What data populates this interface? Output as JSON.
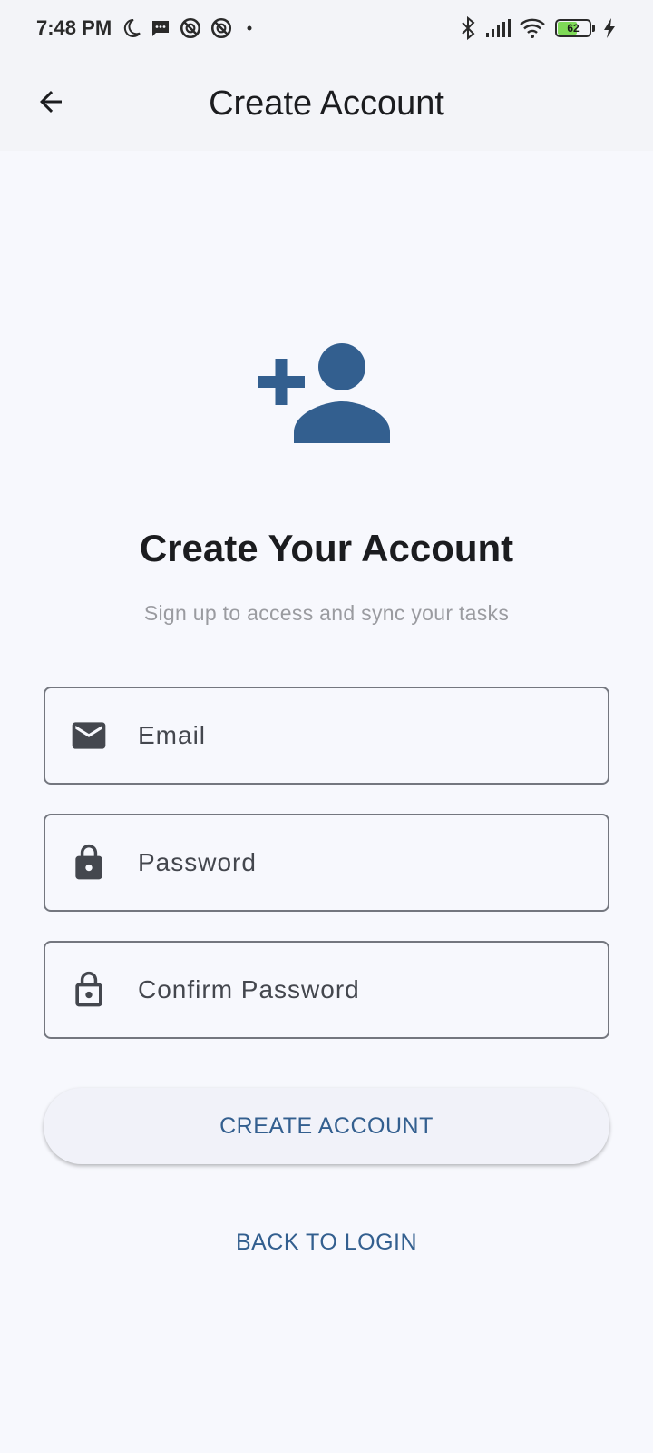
{
  "status_bar": {
    "time": "7:48 PM",
    "left_icons": [
      "moon-icon",
      "message-icon",
      "no-disturb-icon",
      "no-disturb-icon",
      "dot-icon"
    ],
    "right_icons": [
      "bluetooth-icon",
      "signal-icon",
      "wifi-icon"
    ],
    "battery_level": "62",
    "battery_fraction": 0.62,
    "charging": true
  },
  "app_bar": {
    "title": "Create Account",
    "back_icon": "arrow-back-icon"
  },
  "hero": {
    "icon": "person-add-icon",
    "icon_color": "#335f8f",
    "heading": "Create Your Account",
    "subheading": "Sign up to access and sync your tasks"
  },
  "form": {
    "email": {
      "placeholder": "Email",
      "value": "",
      "icon": "mail-icon"
    },
    "password": {
      "placeholder": "Password",
      "value": "",
      "icon": "lock-icon"
    },
    "confirm_password": {
      "placeholder": "Confirm Password",
      "value": "",
      "icon": "lock-open-icon"
    }
  },
  "actions": {
    "create_account_label": "CREATE ACCOUNT",
    "back_to_login_label": "BACK TO LOGIN"
  },
  "colors": {
    "accent": "#335f8f",
    "background": "#f7f8fd",
    "field_border": "#74777f",
    "icon_dark": "#44474e"
  }
}
